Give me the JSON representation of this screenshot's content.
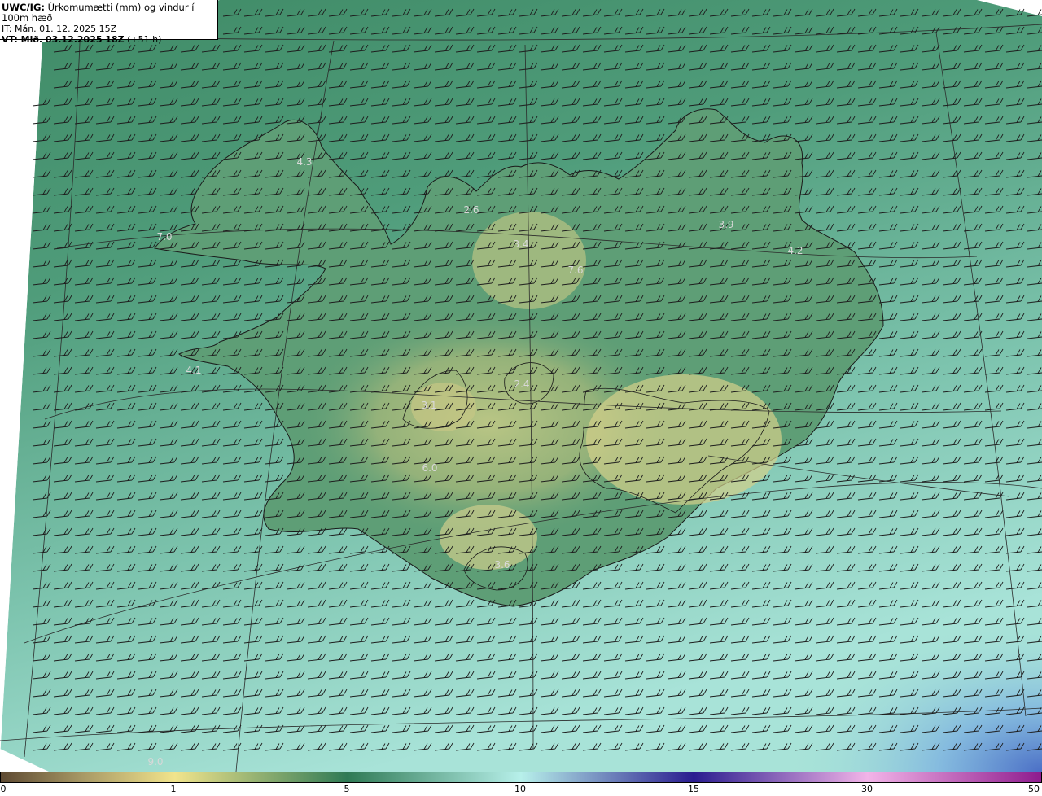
{
  "header": {
    "line1_prefix": "UWC/IG:",
    "line1_text": " Úrkomumætti (mm) og vindur í 100m hæð",
    "line2": "IT: Mán. 01. 12. 2025 15Z",
    "line3_prefix": "VT: Mið. 03.12.2025 18Z",
    "line3_text": " (+51 h)"
  },
  "map_values": [
    {
      "id": "v1",
      "text": "4.3"
    },
    {
      "id": "v2",
      "text": "7.0"
    },
    {
      "id": "v3",
      "text": "2.6"
    },
    {
      "id": "v4",
      "text": "3.4"
    },
    {
      "id": "v5",
      "text": "7.6"
    },
    {
      "id": "v6",
      "text": "3.9"
    },
    {
      "id": "v7",
      "text": "4.2"
    },
    {
      "id": "v8",
      "text": "4.1"
    },
    {
      "id": "v9",
      "text": "3.1"
    },
    {
      "id": "v10",
      "text": "2.4"
    },
    {
      "id": "v11",
      "text": "6.0"
    },
    {
      "id": "v12",
      "text": "3.6"
    },
    {
      "id": "v13",
      "text": "9.0"
    }
  ],
  "colorbar": {
    "labels": [
      "0",
      "1",
      "5",
      "10",
      "15",
      "30",
      "50"
    ],
    "colors": [
      "#5e4a32",
      "#a99a66",
      "#f1e48c",
      "#2f7a55",
      "#b7f0ea",
      "#2a1c8f",
      "#f2b4e8",
      "#8e1c8e"
    ]
  }
}
